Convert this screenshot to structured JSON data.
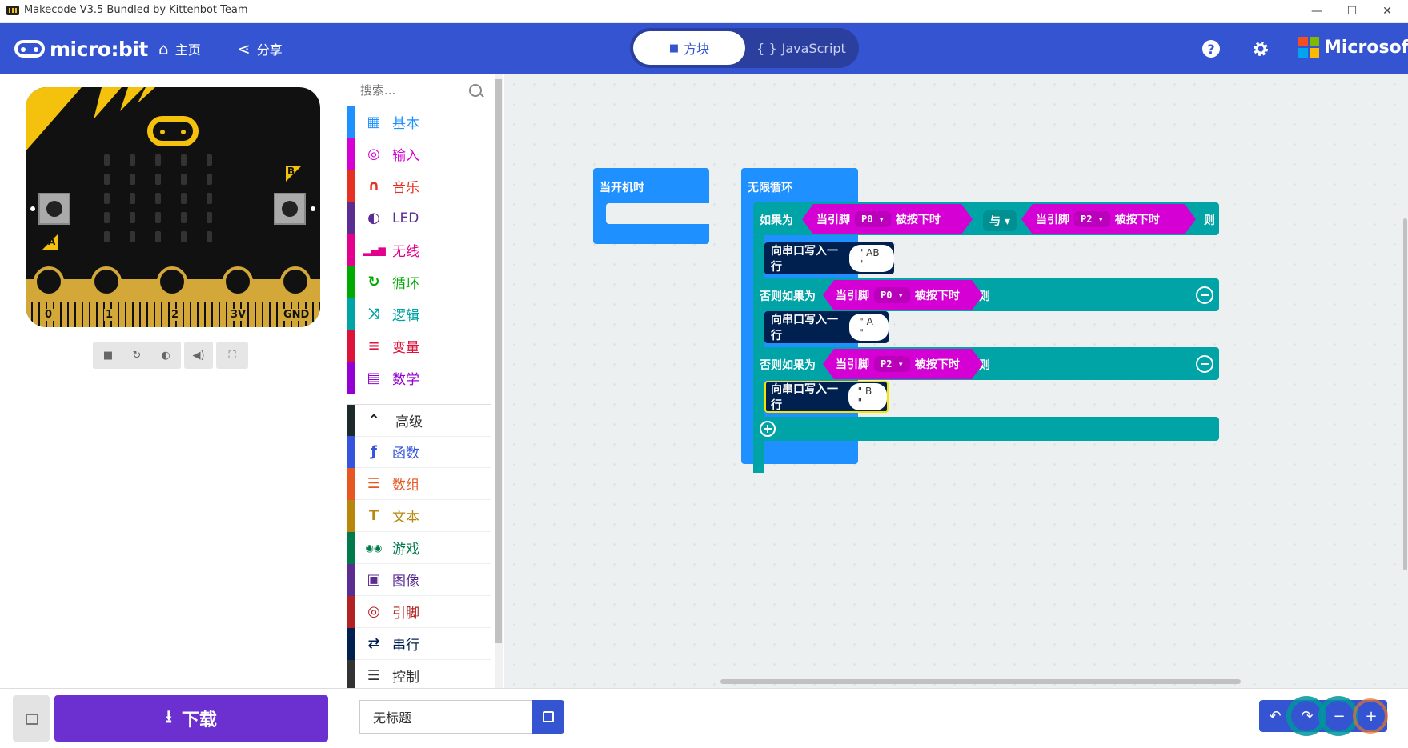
{
  "window": {
    "title": "Makecode V3.5 Bundled by Kittenbot Team",
    "minimize": "—",
    "maximize": "☐",
    "close": "✕"
  },
  "header": {
    "logo_text": "micro:bit",
    "home_label": "主页",
    "share_label": "分享",
    "blocks_label": "方块",
    "javascript_label": "JavaScript",
    "javascript_icon": "{ }",
    "help_label": "?",
    "brand": "Microsoft"
  },
  "simulator": {
    "pins": [
      "0",
      "1",
      "2",
      "3V",
      "GND"
    ],
    "button_a": "A",
    "button_b": "B",
    "controls": [
      "stop-icon",
      "restart-icon",
      "slowmo-icon",
      "mute-icon",
      "fullscreen-icon"
    ]
  },
  "toolbox": {
    "search_placeholder": "搜索...",
    "categories": [
      {
        "label": "基本",
        "color": "#1e90ff",
        "icon": "grid-icon"
      },
      {
        "label": "输入",
        "color": "#d400d4",
        "icon": "target-icon"
      },
      {
        "label": "音乐",
        "color": "#e63022",
        "icon": "headphones-icon"
      },
      {
        "label": "LED",
        "color": "#5c2d91",
        "icon": "toggle-icon"
      },
      {
        "label": "无线",
        "color": "#e3008c",
        "icon": "signal-icon"
      },
      {
        "label": "循环",
        "color": "#00aa00",
        "icon": "refresh-icon"
      },
      {
        "label": "逻辑",
        "color": "#00a4a6",
        "icon": "shuffle-icon"
      },
      {
        "label": "变量",
        "color": "#dc143c",
        "icon": "list-icon"
      },
      {
        "label": "数学",
        "color": "#9400d3",
        "icon": "calculator-icon"
      }
    ],
    "advanced_label": "高级",
    "advanced_categories": [
      {
        "label": "函数",
        "color": "#3455db",
        "icon": "function-icon"
      },
      {
        "label": "数组",
        "color": "#e65722",
        "icon": "array-icon"
      },
      {
        "label": "文本",
        "color": "#b8860b",
        "icon": "text-icon"
      },
      {
        "label": "游戏",
        "color": "#007a4b",
        "icon": "gamepad-icon"
      },
      {
        "label": "图像",
        "color": "#5c2d91",
        "icon": "image-icon"
      },
      {
        "label": "引脚",
        "color": "#b22222",
        "icon": "pin-icon"
      },
      {
        "label": "串行",
        "color": "#002050",
        "icon": "usb-icon"
      },
      {
        "label": "控制",
        "color": "#333333",
        "icon": "control-icon"
      }
    ]
  },
  "workspace": {
    "on_start": "当开机时",
    "forever": "无限循环",
    "if_label": "如果为",
    "then_label": "则",
    "else_if_label": "否则如果为",
    "and_label": "与",
    "pin_pressed_prefix": "当引脚",
    "pin_pressed_suffix": "被按下时",
    "pin_p0": "P0",
    "pin_p2": "P2",
    "serial_write_line": "向串口写入一行",
    "str_ab": "\" AB \"",
    "str_a": "\" A \"",
    "str_b": "\" B \""
  },
  "bottom": {
    "download_label": "下载",
    "project_name": "无标题"
  },
  "colors": {
    "header_blue": "#3454d1",
    "download_purple": "#6c2fd0",
    "events_blue": "#1e90ff",
    "logic_teal": "#00a4a6",
    "input_magenta": "#d400d4",
    "serial_navy": "#002050"
  }
}
